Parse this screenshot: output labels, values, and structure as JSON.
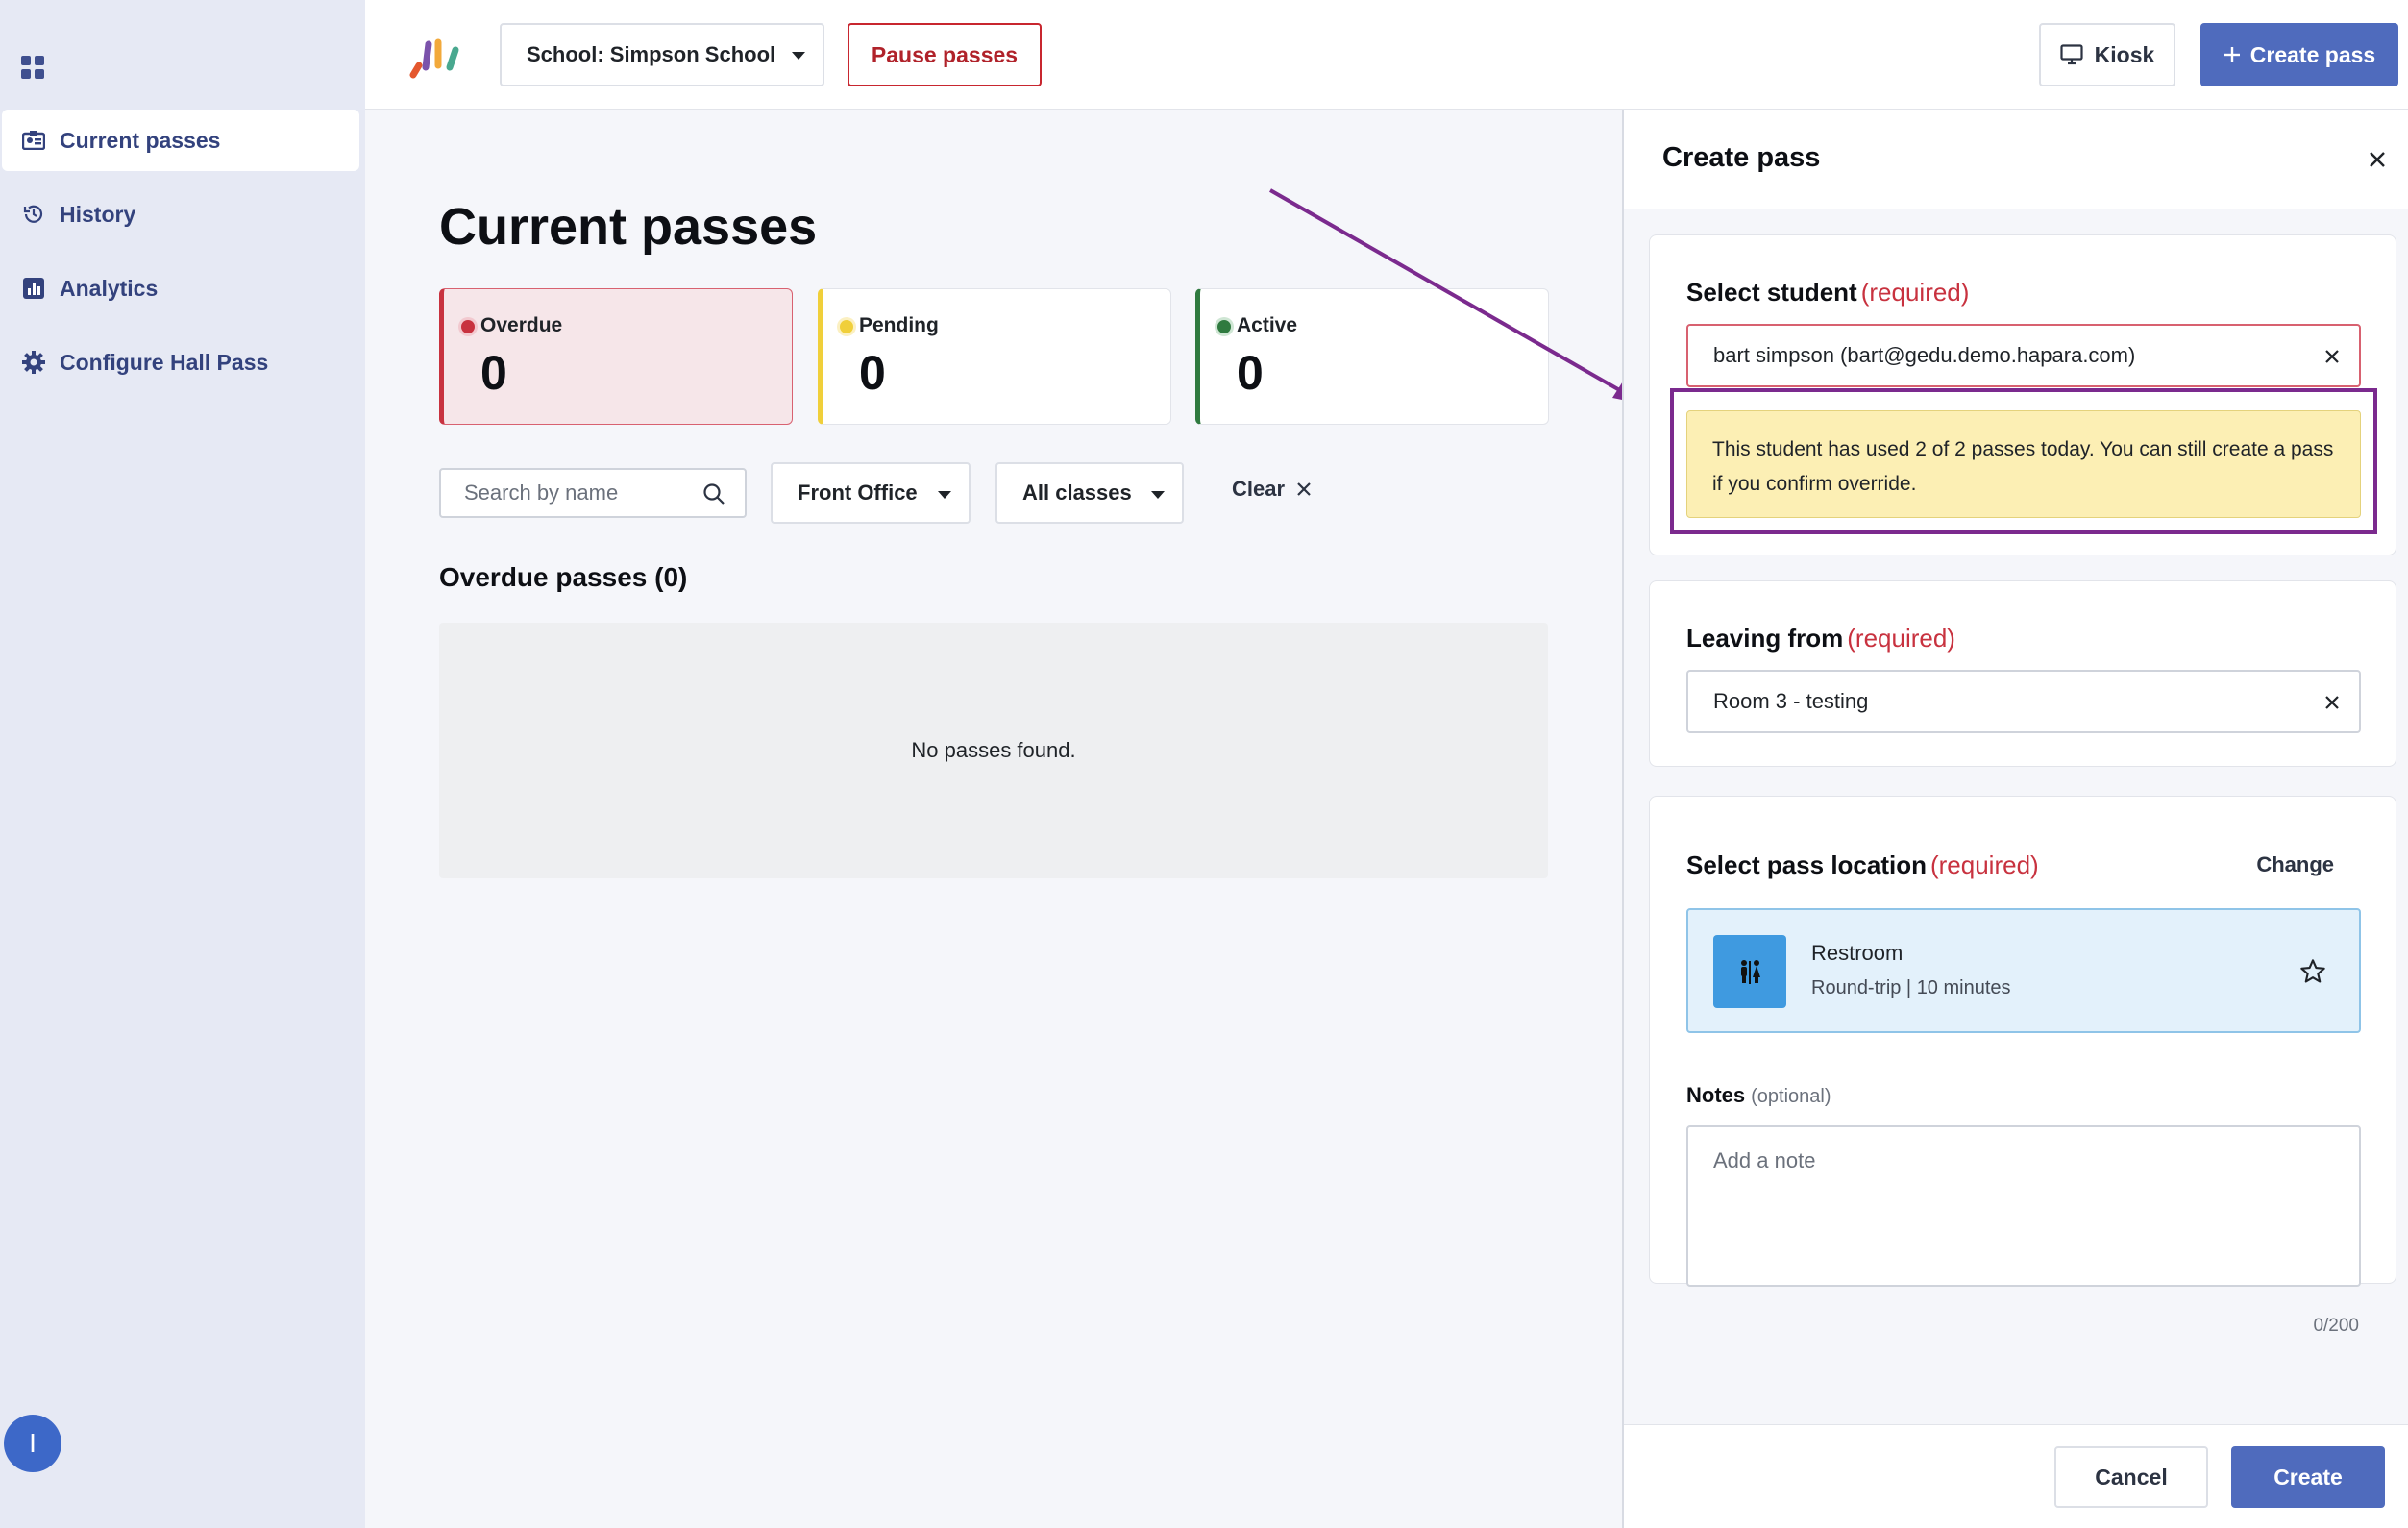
{
  "sidebar": {
    "items": [
      {
        "label": "Current passes",
        "icon": "badge-icon",
        "active": true
      },
      {
        "label": "History",
        "icon": "history-icon",
        "active": false
      },
      {
        "label": "Analytics",
        "icon": "chart-icon",
        "active": false
      },
      {
        "label": "Configure Hall Pass",
        "icon": "gear-icon",
        "active": false
      }
    ],
    "avatar_initial": "I"
  },
  "topbar": {
    "school_select": "School: Simpson School",
    "pause_label": "Pause passes",
    "kiosk_label": "Kiosk",
    "create_label": "Create pass"
  },
  "main": {
    "title": "Current passes",
    "stats": {
      "overdue": {
        "label": "Overdue",
        "value": "0",
        "color": "#c8323f"
      },
      "pending": {
        "label": "Pending",
        "value": "0",
        "color": "#f0cf3a"
      },
      "active": {
        "label": "Active",
        "value": "0",
        "color": "#2f7a3f"
      }
    },
    "search_placeholder": "Search by name",
    "filter_location": "Front Office",
    "filter_classes": "All classes",
    "clear_label": "Clear",
    "section_title": "Overdue passes (0)",
    "empty_text": "No passes found."
  },
  "panel": {
    "title": "Create pass",
    "select_student": {
      "label": "Select student",
      "required": "(required)",
      "value": "bart simpson (bart@gedu.demo.hapara.com)",
      "warning": "This student has used 2 of 2 passes today. You can still create a pass if you confirm override."
    },
    "leaving_from": {
      "label": "Leaving from",
      "required": "(required)",
      "value": "Room 3 - testing"
    },
    "pass_location": {
      "label": "Select pass location",
      "required": "(required)",
      "change_label": "Change",
      "name": "Restroom",
      "details": "Round-trip | 10 minutes"
    },
    "notes": {
      "label": "Notes",
      "optional": "(optional)",
      "placeholder": "Add a note",
      "counter": "0/200"
    },
    "cancel_label": "Cancel",
    "submit_label": "Create"
  },
  "colors": {
    "accent": "#4f6bbd",
    "annotation": "#7b2a8e",
    "warning_bg": "#fcefb4"
  }
}
